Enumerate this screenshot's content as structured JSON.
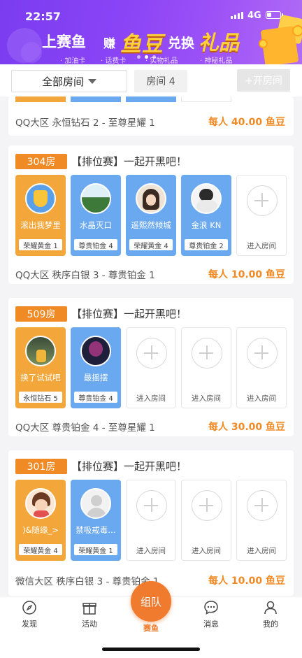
{
  "status_bar": {
    "time": "22:57",
    "network": "4G"
  },
  "banner": {
    "left_text": "上赛鱼",
    "earn": "赚",
    "yudou": "鱼豆",
    "exchange": "兑换",
    "gift": "礼品",
    "subs": [
      "· 加油卡",
      "· 话费卡",
      "· 实物礼品",
      "· 神秘礼品"
    ]
  },
  "filter": {
    "all_rooms": "全部房间",
    "room_number": "房间 4",
    "open_room": "+开房间"
  },
  "partial_card": {
    "footer": "QQ大区  永恒钻石 2 - 至尊星耀 1",
    "price": "每人 40.00 鱼豆"
  },
  "rooms": [
    {
      "badge": "304房",
      "title": "【排位赛】一起开黑吧！",
      "players": [
        {
          "name": "滚出我梦里",
          "rank": "荣耀黄金 1",
          "color": "orange"
        },
        {
          "name": "水晶灭口",
          "rank": "尊贵铂金 4",
          "color": "blue"
        },
        {
          "name": "遥熙然倾城",
          "rank": "荣耀黄金 4",
          "color": "blue"
        },
        {
          "name": "金浪 KN",
          "rank": "尊贵铂金 2",
          "color": "blue"
        }
      ],
      "empty_label": "进入房间",
      "footer": "QQ大区  秩序白银 3 - 尊贵铂金 1",
      "price": "每人 10.00 鱼豆"
    },
    {
      "badge": "509房",
      "title": "【排位赛】一起开黑吧！",
      "players": [
        {
          "name": "换了试试吧",
          "rank": "永恒钻石 5",
          "color": "orange"
        },
        {
          "name": "最摇摆",
          "rank": "尊贵铂金 4",
          "color": "blue"
        }
      ],
      "empty_label": "进入房间",
      "footer": "QQ大区  尊贵铂金 4 - 至尊星耀 1",
      "price": "每人 30.00 鱼豆"
    },
    {
      "badge": "301房",
      "title": "【排位赛】一起开黑吧！",
      "players": [
        {
          "name": ")&随缘_>",
          "rank": "荣耀黄金 4",
          "color": "orange"
        },
        {
          "name": "禁吸戒毒…",
          "rank": "荣耀黄金 1",
          "color": "blue"
        }
      ],
      "empty_label": "进入房间",
      "footer": "微信大区  秩序白银 3 - 尊贵铂金 1",
      "price": "每人 10.00 鱼豆"
    }
  ],
  "tabs": [
    {
      "label": "发现",
      "icon": "compass-icon"
    },
    {
      "label": "活动",
      "icon": "gift-icon"
    },
    {
      "label": "赛鱼",
      "icon": "team-button",
      "center": "组队"
    },
    {
      "label": "消息",
      "icon": "message-icon"
    },
    {
      "label": "我的",
      "icon": "user-icon"
    }
  ],
  "colors": {
    "orange": "#f08a24",
    "blue": "#6aa8f0",
    "purple": "#8a44f6"
  }
}
